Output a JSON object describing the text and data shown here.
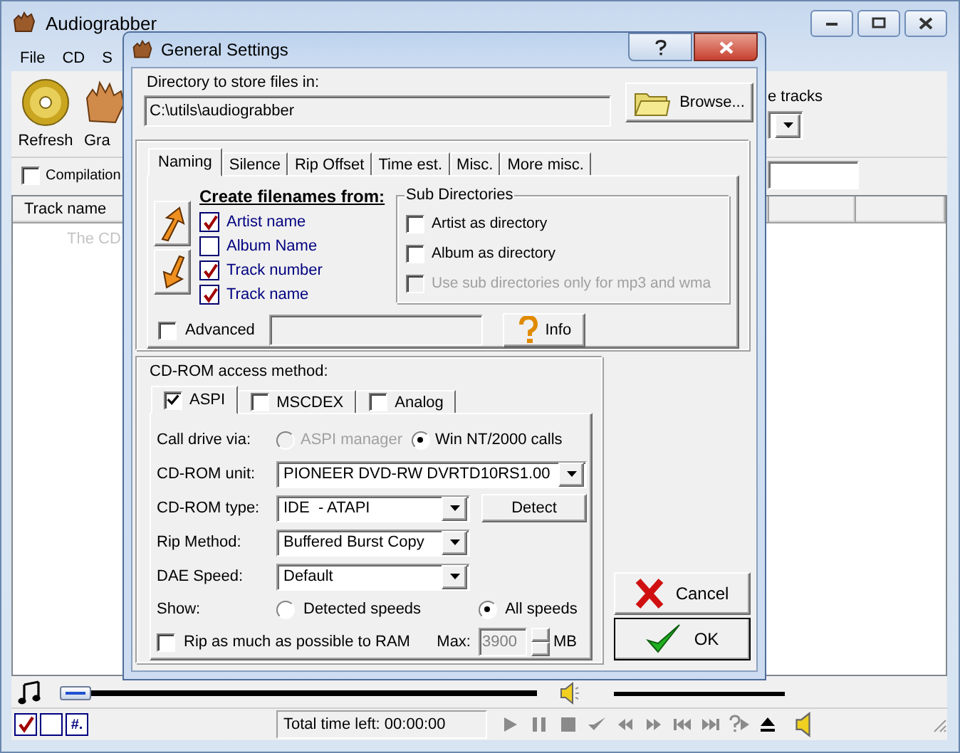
{
  "main_window": {
    "title": "Audiograbber",
    "menu": [
      "File",
      "CD",
      "S"
    ],
    "toolbar": [
      {
        "label": "Refresh",
        "kind": "disc"
      },
      {
        "label": "Gra",
        "kind": "hand"
      }
    ],
    "tracks_label": "e tracks",
    "compilation": {
      "label": "Compilation",
      "checked": false
    },
    "table": {
      "columns": [
        "Track name"
      ],
      "empty_hint": "The CD"
    },
    "seek": {
      "level": 0
    },
    "status_toggles": [
      {
        "kind": "tick"
      },
      {
        "kind": "box"
      },
      {
        "kind": "text",
        "label": "#."
      }
    ],
    "time_left": "Total time left: 00:00:00"
  },
  "dialog": {
    "title": "General Settings",
    "directory": {
      "label": "Directory to store files in:",
      "value": "C:\\utils\\audiograbber"
    },
    "browse": "Browse...",
    "tabs": [
      {
        "label": "Naming",
        "selected": true
      },
      {
        "label": "Silence",
        "selected": false
      },
      {
        "label": "Rip Offset",
        "selected": false
      },
      {
        "label": "Time est.",
        "selected": false
      },
      {
        "label": "Misc.",
        "selected": false
      },
      {
        "label": "More misc.",
        "selected": false
      }
    ],
    "naming": {
      "heading": "Create filenames from:",
      "fields": [
        {
          "label": "Artist name",
          "checked": true
        },
        {
          "label": "Album Name",
          "checked": false
        },
        {
          "label": "Track number",
          "checked": true
        },
        {
          "label": "Track name",
          "checked": true
        }
      ],
      "sub_directories": {
        "title": "Sub Directories",
        "options": [
          {
            "label": "Artist as directory",
            "checked": false,
            "disabled": false
          },
          {
            "label": "Album as directory",
            "checked": false,
            "disabled": false
          },
          {
            "label": "Use sub directories only for mp3 and wma",
            "checked": false,
            "disabled": true
          }
        ]
      },
      "advanced": {
        "label": "Advanced",
        "checked": false
      },
      "info": "Info"
    },
    "cdrom": {
      "title": "CD-ROM access method:",
      "tabs": [
        {
          "label": "ASPI",
          "checked": true,
          "selected": true
        },
        {
          "label": "MSCDEX",
          "checked": false,
          "selected": false
        },
        {
          "label": "Analog",
          "checked": false,
          "selected": false
        }
      ],
      "call_via": {
        "label": "Call drive via:",
        "options": [
          {
            "label": "ASPI manager",
            "selected": false,
            "disabled": true
          },
          {
            "label": "Win NT/2000 calls",
            "selected": true,
            "disabled": false
          }
        ]
      },
      "selects": [
        {
          "label": "CD-ROM unit:",
          "value": "PIONEER DVD-RW DVRTD10RS1.00",
          "kind": "wide"
        },
        {
          "label": "CD-ROM type:",
          "value": "IDE  - ATAPI",
          "kind": "narrow",
          "button": "Detect"
        },
        {
          "label": "Rip Method:",
          "value": "Buffered Burst Copy",
          "kind": "narrow"
        },
        {
          "label": "DAE Speed:",
          "value": "Default",
          "kind": "narrow"
        }
      ],
      "show": {
        "label": "Show:",
        "options": [
          {
            "label": "Detected speeds",
            "selected": false
          },
          {
            "label": "All speeds",
            "selected": true
          }
        ]
      },
      "ram": {
        "label": "Rip as much as possible to RAM",
        "checked": false,
        "max_label": "Max:",
        "max_value": "3900",
        "unit": "MB",
        "disabled": true
      }
    },
    "buttons": [
      {
        "label": "Cancel",
        "kind": "cancel",
        "default": false
      },
      {
        "label": "OK",
        "kind": "ok",
        "default": true
      }
    ]
  }
}
